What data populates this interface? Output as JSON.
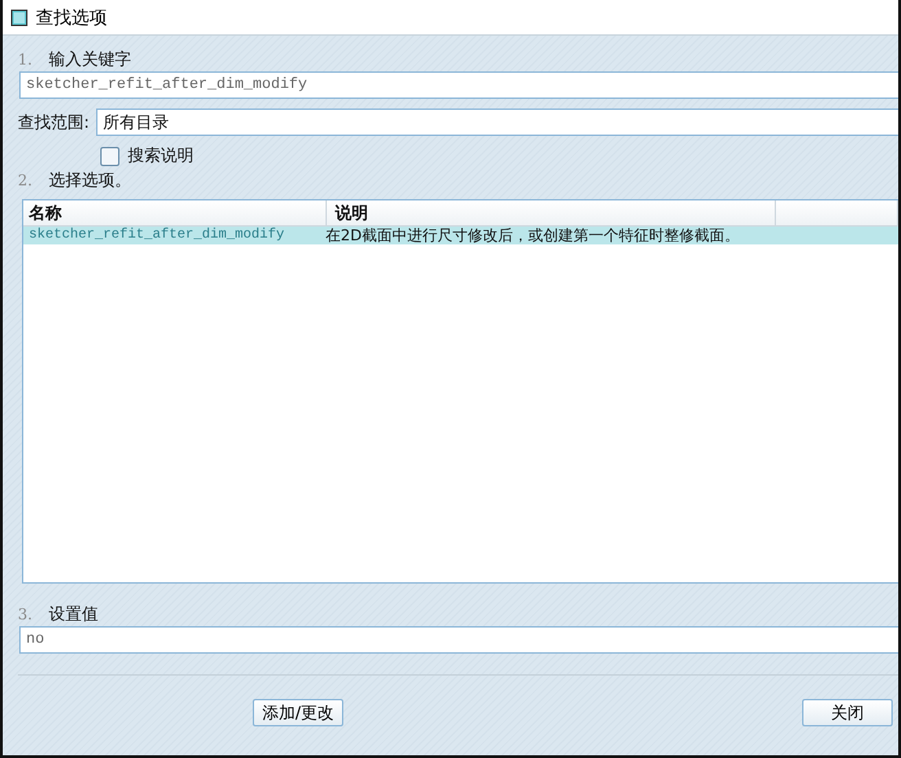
{
  "window": {
    "title": "查找选项"
  },
  "step1": {
    "number": "1.",
    "label": "输入关键字",
    "value": "sketcher_refit_after_dim_modify"
  },
  "scope": {
    "label": "查找范围:",
    "value": "所有目录"
  },
  "search_description": {
    "label": "搜索说明",
    "checked": false
  },
  "step2": {
    "number": "2.",
    "label": "选择选项。"
  },
  "table": {
    "columns": [
      "名称",
      "说明"
    ],
    "rows": [
      {
        "name": "sketcher_refit_after_dim_modify",
        "description": "在2D截面中进行尺寸修改后，或创建第一个特征时整修截面。",
        "selected": true
      }
    ]
  },
  "step3": {
    "number": "3.",
    "label": "设置值",
    "value": "no"
  },
  "buttons": [
    {
      "label": "添加/更改",
      "kind": "add"
    },
    {
      "label": "关闭",
      "kind": "close"
    }
  ]
}
